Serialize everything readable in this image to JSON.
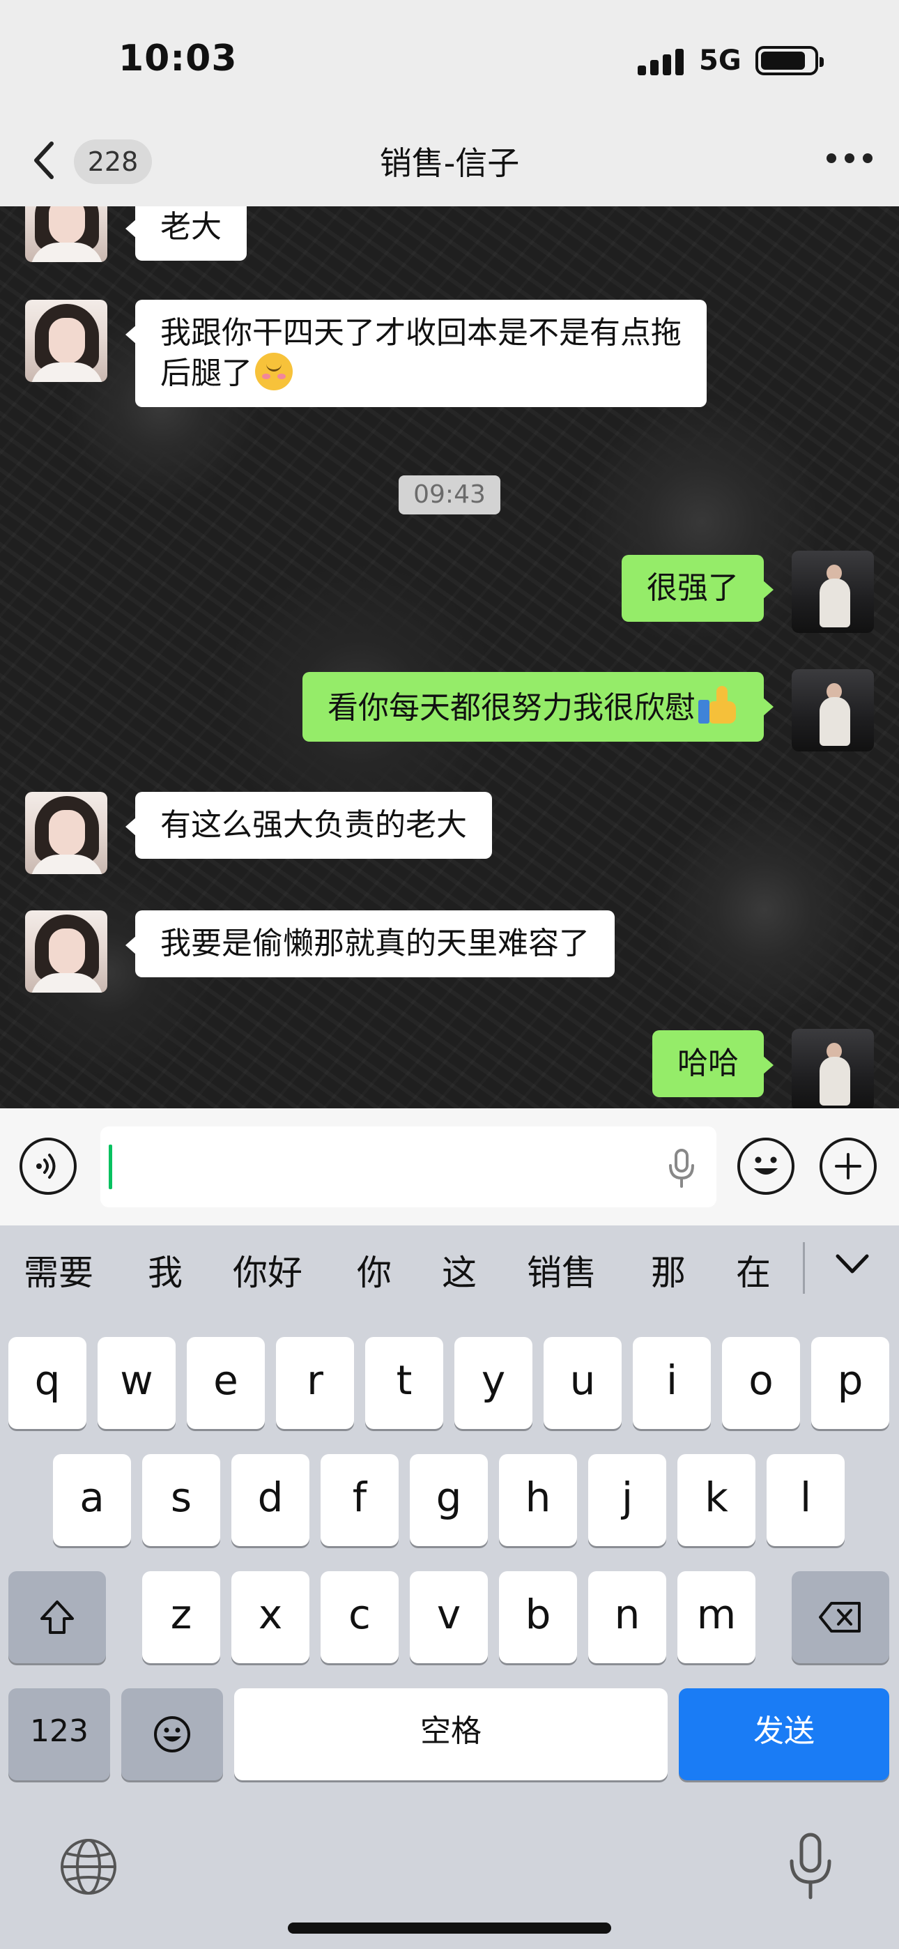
{
  "status_bar": {
    "time": "10:03",
    "network": "5G",
    "battery_level": 0.85
  },
  "header": {
    "back_icon": "chevron-left-icon",
    "unread_count": "228",
    "title": "销售-信子",
    "more_icon": "more-dots-icon"
  },
  "messages": [
    {
      "from": "other",
      "text": "老大"
    },
    {
      "from": "other",
      "text_line1": "我跟你干四天了才收回本是不是有点拖",
      "text_line2": "后腿了",
      "emoji": "smiling-face-with-blush"
    },
    {
      "type": "timestamp",
      "text": "09:43"
    },
    {
      "from": "self",
      "text": "很强了"
    },
    {
      "from": "self",
      "text": "看你每天都很努力我很欣慰",
      "emoji": "thumbs-up"
    },
    {
      "from": "other",
      "text": "有这么强大负责的老大"
    },
    {
      "from": "other",
      "text": "我要是偷懒那就真的天里难容了"
    },
    {
      "from": "self",
      "text": "哈哈"
    }
  ],
  "input_bar": {
    "voice_icon": "voice-icon",
    "emoji_icon": "emoji-icon",
    "add_icon": "plus-icon",
    "mic_icon": "mic-icon",
    "value": ""
  },
  "keyboard": {
    "suggestions": [
      "需要",
      "我",
      "你好",
      "你",
      "这",
      "销售",
      "那",
      "在"
    ],
    "row1": [
      "q",
      "w",
      "e",
      "r",
      "t",
      "y",
      "u",
      "i",
      "o",
      "p"
    ],
    "row2": [
      "a",
      "s",
      "d",
      "f",
      "g",
      "h",
      "j",
      "k",
      "l"
    ],
    "row3": [
      "z",
      "x",
      "c",
      "v",
      "b",
      "n",
      "m"
    ],
    "numbers_label": "123",
    "space_label": "空格",
    "send_label": "发送",
    "send_color": "#1a7cf5"
  },
  "colors": {
    "self_bubble": "#95ec69",
    "other_bubble": "#ffffff",
    "caret": "#07c160"
  }
}
